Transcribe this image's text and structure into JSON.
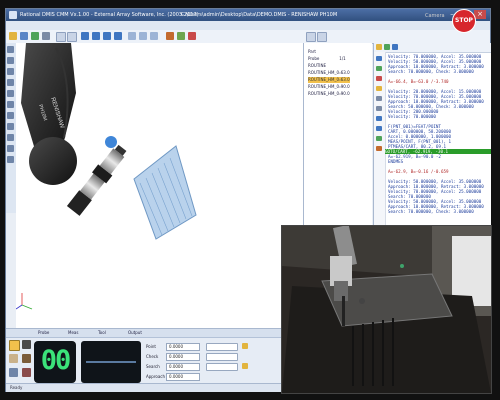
{
  "window": {
    "title": "Rational DMIS CMM Vx.1.00 - External Array Software, Inc. (2003-2017)",
    "path": "C:\\Users\\admin\\Desktop\\Data\\DEMO.DMIS - RENISHAW PH10M",
    "minimize": "–",
    "maximize": "□",
    "close": "×"
  },
  "overlay": {
    "stop_label": "STOP",
    "camera_caption": "Camera"
  },
  "viewport": {
    "probe_brand": "RENISHAW",
    "probe_model": "PH10M"
  },
  "tree": {
    "items": [
      {
        "label": "Part",
        "value": "",
        "highlight": false
      },
      {
        "label": "Probe",
        "value": "1/1",
        "highlight": false
      },
      {
        "label": "ROUTINE",
        "value": "",
        "highlight": false
      },
      {
        "label": "ROUTINE_HM_0...",
        "value": "-63.0",
        "highlight": false
      },
      {
        "label": "ROUTINE_HM_0...",
        "value": "-63.0",
        "highlight": true
      },
      {
        "label": "ROUTINE_HM_0...",
        "value": "-90.0",
        "highlight": false
      },
      {
        "label": "ROUTINE_HM_0...",
        "value": "-90.0",
        "highlight": false
      }
    ]
  },
  "edit": {
    "lines": [
      {
        "text": "Velocity: 70.000000, Accel: 35.000000",
        "style": "normal"
      },
      {
        "text": "Velocity: 50.000000, Accel: 35.000000",
        "style": "normal"
      },
      {
        "text": "Approach: 10.000000, Retract: 3.000000",
        "style": "normal"
      },
      {
        "text": "Search: 70.000000, Check: 3.000000",
        "style": "normal"
      },
      {
        "text": "",
        "style": "normal"
      },
      {
        "text": "A=-66.4, B=-63.0 /-3.740",
        "style": "red"
      },
      {
        "text": "",
        "style": "normal"
      },
      {
        "text": "Velocity: 20.000000, Accel: 15.000000",
        "style": "normal"
      },
      {
        "text": "Velocity: 70.000000, Accel: 35.000000",
        "style": "normal"
      },
      {
        "text": "Approach: 10.000000, Retract: 3.000000",
        "style": "normal"
      },
      {
        "text": "Search: 50.000000, Check: 3.000000",
        "style": "normal"
      },
      {
        "text": "Velocity: 200.000000",
        "style": "normal"
      },
      {
        "text": "Velocity: 70.000000",
        "style": "normal"
      },
      {
        "text": "",
        "style": "normal"
      },
      {
        "text": "F(PNT_001)=FEAT/POINT",
        "style": "normal"
      },
      {
        "text": "  CART, 0.000000, 58.200000",
        "style": "normal"
      },
      {
        "text": "  Accel: 0.000000, 1.000000",
        "style": "normal"
      },
      {
        "text": "  MEAS/POINT, F(PNT_001), 1",
        "style": "normal"
      },
      {
        "text": "  PTMEAS/CART, 80.2, 69.1",
        "style": "normal"
      },
      {
        "text": "GOTO/CART, -62.919, -30.1",
        "style": "highlight"
      },
      {
        "text": "  A=-62.919, B=-90.0 -2",
        "style": "normal"
      },
      {
        "text": "ENDMES",
        "style": "normal"
      },
      {
        "text": "",
        "style": "normal"
      },
      {
        "text": "A=-62.9, B=-0.16 /-0.659",
        "style": "red"
      },
      {
        "text": "",
        "style": "normal"
      },
      {
        "text": "Velocity: 50.000000, Accel: 35.000000",
        "style": "normal"
      },
      {
        "text": "Approach: 10.000000, Retract: 3.000000",
        "style": "normal"
      },
      {
        "text": "Velocity: 70.000000, Accel: 25.000000",
        "style": "normal"
      },
      {
        "text": "Search: 70.000000",
        "style": "normal"
      },
      {
        "text": "Velocity: 50.000000, Accel: 35.000000",
        "style": "normal"
      },
      {
        "text": "Approach: 10.000000, Retract: 3.000000",
        "style": "normal"
      },
      {
        "text": "Search: 70.000000, Check: 3.000000",
        "style": "normal"
      }
    ]
  },
  "bottom": {
    "tabs": [
      "Probe",
      "Meas",
      "Tool",
      "Output"
    ],
    "counter": "00",
    "field_labels": [
      "Point",
      "Check",
      "Search",
      "Approach"
    ],
    "field_values": [
      "0.0000",
      "0.0000",
      "0.0000",
      "0.0000"
    ]
  },
  "status": {
    "text": "Ready"
  },
  "colors": {
    "accent": "#31507f",
    "highlight_row": "#f2c14c",
    "code_highlight": "#2a9c2a",
    "counter_digits": "#3be27a",
    "stop_red": "#d7262c"
  }
}
